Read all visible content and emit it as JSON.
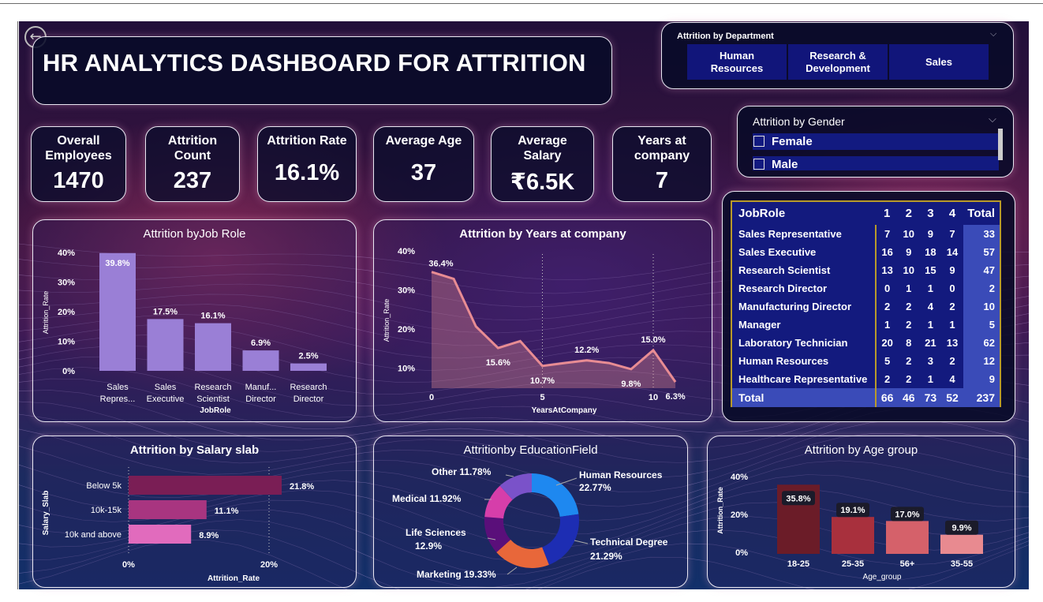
{
  "dashboard": {
    "title": "HR ANALYTICS DASHBOARD FOR ATTRITION",
    "back_icon": "back-arrow-icon"
  },
  "kpis": [
    {
      "label_line1": "Overall",
      "label_line2": "Employees",
      "value": "1470"
    },
    {
      "label_line1": "Attrition",
      "label_line2": "Count",
      "value": "237"
    },
    {
      "label_line1": "Attrition Rate",
      "label_line2": "",
      "value": "16.1%"
    },
    {
      "label_line1": "Average Age",
      "label_line2": "",
      "value": "37"
    },
    {
      "label_line1": "Average",
      "label_line2": "Salary",
      "value": "₹6.5K"
    },
    {
      "label_line1": "Years at",
      "label_line2": "company",
      "value": "7"
    }
  ],
  "department_slicer": {
    "title": "Attrition by Department",
    "options": [
      {
        "line1": "Human",
        "line2": "Resources"
      },
      {
        "line1": "Research &",
        "line2": "Development"
      },
      {
        "line1": "Sales",
        "line2": ""
      }
    ]
  },
  "gender_slicer": {
    "title": "Attrition by Gender",
    "options": [
      "Female",
      "Male"
    ]
  },
  "colors": {
    "bar_purple": "#9a7fd6",
    "line_pink": "#e88c93",
    "salary_bar1": "#7a1e55",
    "salary_bar2": "#a83580",
    "salary_bar3": "#e16bbd",
    "age_bar1": "#6b1c28",
    "age_bar2": "#a8303d",
    "age_bar3": "#d5616a",
    "age_bar4": "#e88a90",
    "donut_hr": "#1e88f0",
    "donut_tech": "#1d2db3",
    "donut_marketing": "#e8673a",
    "donut_life": "#5a0f7a",
    "donut_medical": "#d63eaa",
    "donut_other": "#7a52c9",
    "matrix_bg": "#131a7e",
    "matrix_total_bg": "#3a4bb8"
  },
  "charts": {
    "job_role": {
      "title": "Attrition byJob Role",
      "ylabel": "Attrition_Rate",
      "xlabel": "JobRole",
      "y_ticks": [
        "40%",
        "30%",
        "20%",
        "10%",
        "0%"
      ],
      "categories": [
        {
          "line1": "Sales",
          "line2": "Repres..."
        },
        {
          "line1": "Sales",
          "line2": "Executive"
        },
        {
          "line1": "Research",
          "line2": "Scientist"
        },
        {
          "line1": "Manuf...",
          "line2": "Director"
        },
        {
          "line1": "Research",
          "line2": "Director"
        }
      ],
      "value_labels": [
        "39.8%",
        "17.5%",
        "16.1%",
        "6.9%",
        "2.5%"
      ]
    },
    "years": {
      "title": "Attrition by Years at company",
      "ylabel": "Attrition_Rate",
      "xlabel": "YearsAtCompany",
      "y_ticks": [
        "40%",
        "30%",
        "20%",
        "10%"
      ],
      "x_ticks": [
        "0",
        "5",
        "10"
      ],
      "point_labels": [
        "36.4%",
        "15.6%",
        "10.7%",
        "12.2%",
        "9.8%",
        "15.0%",
        "6.3%"
      ]
    },
    "salary": {
      "title": "Attrition by Salary slab",
      "ylabel": "Salary_Slab",
      "xlabel": "Attrition_Rate",
      "x_ticks": [
        "0%",
        "20%"
      ],
      "categories": [
        "Below 5k",
        "10k-15k",
        "10k and above"
      ],
      "value_labels": [
        "21.8%",
        "11.1%",
        "8.9%"
      ]
    },
    "education": {
      "title": "Attritionby EducationField",
      "slice_labels": {
        "hr_name": "Human Resources",
        "hr_pct": "22.77%",
        "tech_name": "Technical Degree",
        "tech_pct": "21.29%",
        "marketing": "Marketing 19.33%",
        "life_name": "Life Sciences",
        "life_pct": "12.9%",
        "medical": "Medical 11.92%",
        "other": "Other 11.78%"
      }
    },
    "age": {
      "title": "Attrition by Age group",
      "ylabel": "Attrition_Rate",
      "xlabel": "Age_group",
      "y_ticks": [
        "40%",
        "20%",
        "0%"
      ],
      "categories": [
        "18-25",
        "25-35",
        "56+",
        "35-55"
      ],
      "value_labels": [
        "35.8%",
        "19.1%",
        "17.0%",
        "9.9%"
      ]
    }
  },
  "chart_data": [
    {
      "type": "bar",
      "title": "Attrition byJob Role",
      "categories": [
        "Sales Repres...",
        "Sales Executive",
        "Research Scientist",
        "Manuf... Director",
        "Research Director"
      ],
      "values": [
        39.8,
        17.5,
        16.1,
        6.9,
        2.5
      ],
      "xlabel": "JobRole",
      "ylabel": "Attrition_Rate",
      "ylim": [
        0,
        40
      ]
    },
    {
      "type": "area",
      "title": "Attrition by Years at company",
      "x": [
        0,
        1,
        2,
        3,
        4,
        5,
        6,
        7,
        8,
        9,
        10,
        11
      ],
      "values": [
        36.4,
        34.5,
        21.5,
        15.6,
        17.5,
        10.7,
        11.5,
        12.2,
        11.5,
        9.8,
        15.0,
        6.3
      ],
      "xlabel": "YearsAtCompany",
      "ylabel": "Attrition_Rate",
      "ylim": [
        5,
        40
      ]
    },
    {
      "type": "bar",
      "title": "Attrition by Salary slab",
      "categories": [
        "Below 5k",
        "10k-15k",
        "10k and above"
      ],
      "values": [
        21.8,
        11.1,
        8.9
      ],
      "xlabel": "Attrition_Rate",
      "ylabel": "Salary_Slab",
      "xlim": [
        0,
        20
      ]
    },
    {
      "type": "pie",
      "title": "Attritionby EducationField",
      "categories": [
        "Human Resources",
        "Technical Degree",
        "Marketing",
        "Life Sciences",
        "Medical",
        "Other"
      ],
      "values": [
        22.77,
        21.29,
        19.33,
        12.9,
        11.92,
        11.78
      ]
    },
    {
      "type": "bar",
      "title": "Attrition by Age group",
      "categories": [
        "18-25",
        "25-35",
        "56+",
        "35-55"
      ],
      "values": [
        35.8,
        19.1,
        17.0,
        9.9
      ],
      "xlabel": "Age_group",
      "ylabel": "Attrition_Rate",
      "ylim": [
        0,
        40
      ]
    },
    {
      "type": "table",
      "title": "JobRole",
      "columns": [
        "JobRole",
        "1",
        "2",
        "3",
        "4",
        "Total"
      ],
      "rows": [
        [
          "Sales Representative",
          "7",
          "10",
          "9",
          "7",
          "33"
        ],
        [
          "Sales Executive",
          "16",
          "9",
          "18",
          "14",
          "57"
        ],
        [
          "Research Scientist",
          "13",
          "10",
          "15",
          "9",
          "47"
        ],
        [
          "Research Director",
          "0",
          "1",
          "1",
          "0",
          "2"
        ],
        [
          "Manufacturing Director",
          "2",
          "2",
          "4",
          "2",
          "10"
        ],
        [
          "Manager",
          "1",
          "2",
          "1",
          "1",
          "5"
        ],
        [
          "Laboratory Technician",
          "20",
          "8",
          "21",
          "13",
          "62"
        ],
        [
          "Human Resources",
          "5",
          "2",
          "3",
          "2",
          "12"
        ],
        [
          "Healthcare Representative",
          "2",
          "2",
          "1",
          "4",
          "9"
        ]
      ],
      "total": [
        "Total",
        "66",
        "46",
        "73",
        "52",
        "237"
      ]
    }
  ],
  "matrix": {
    "header": [
      "JobRole",
      "1",
      "2",
      "3",
      "4",
      "Total"
    ],
    "rows": [
      [
        "Sales Representative",
        "7",
        "10",
        "9",
        "7",
        "33"
      ],
      [
        "Sales Executive",
        "16",
        "9",
        "18",
        "14",
        "57"
      ],
      [
        "Research Scientist",
        "13",
        "10",
        "15",
        "9",
        "47"
      ],
      [
        "Research Director",
        "0",
        "1",
        "1",
        "0",
        "2"
      ],
      [
        "Manufacturing Director",
        "2",
        "2",
        "4",
        "2",
        "10"
      ],
      [
        "Manager",
        "1",
        "2",
        "1",
        "1",
        "5"
      ],
      [
        "Laboratory Technician",
        "20",
        "8",
        "21",
        "13",
        "62"
      ],
      [
        "Human Resources",
        "5",
        "2",
        "3",
        "2",
        "12"
      ],
      [
        "Healthcare Representative",
        "2",
        "2",
        "1",
        "4",
        "9"
      ]
    ],
    "total": [
      "Total",
      "66",
      "46",
      "73",
      "52",
      "237"
    ]
  }
}
